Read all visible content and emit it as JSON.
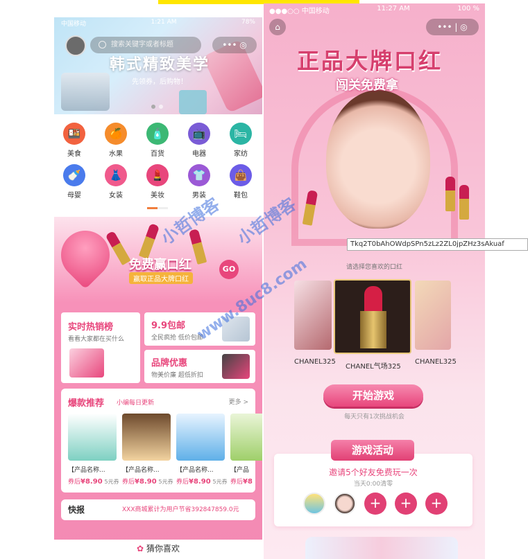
{
  "left": {
    "status": {
      "carrier": "中国移动",
      "time": "1:21 AM",
      "battery": "78%"
    },
    "search_placeholder": "搜索关键字或者标题",
    "capsule": "••• ◎",
    "banner": {
      "title": "韩式精致美学",
      "subtitle": "先领券，后购物！"
    },
    "categories": [
      {
        "label": "美食",
        "color": "#f2623f",
        "icon": "🍱"
      },
      {
        "label": "水果",
        "color": "#f58c2c",
        "icon": "🍊"
      },
      {
        "label": "百货",
        "color": "#3cb874",
        "icon": "🧴"
      },
      {
        "label": "电器",
        "color": "#7a5cd6",
        "icon": "📺"
      },
      {
        "label": "家纺",
        "color": "#2bb5a4",
        "icon": "🛏"
      },
      {
        "label": "母婴",
        "color": "#4a7bec",
        "icon": "🍼"
      },
      {
        "label": "女装",
        "color": "#f05a8c",
        "icon": "👗"
      },
      {
        "label": "美妆",
        "color": "#e8467c",
        "icon": "💄"
      },
      {
        "label": "男装",
        "color": "#9b59d6",
        "icon": "👕"
      },
      {
        "label": "鞋包",
        "color": "#6c5ce7",
        "icon": "👜"
      }
    ],
    "promo": {
      "title": "免费赢口红",
      "subtitle": "赢取正品大牌口红",
      "go": "GO"
    },
    "cards": [
      {
        "title": "实时热销榜",
        "sub": "看看大家都在买什么"
      },
      {
        "title": "9.9包邮",
        "sub": "全民疯抢 低价包邮"
      },
      {
        "title": "品牌优惠",
        "sub": "物美价廉 超低折扣"
      }
    ],
    "hot": {
      "title": "爆款推荐",
      "subtitle": "小编每日更新",
      "more": "更多 >",
      "products": [
        {
          "name": "【产品名称...",
          "prefix": "券后",
          "price": "¥8.90",
          "coupon": "5元券"
        },
        {
          "name": "【产品名称...",
          "prefix": "券后",
          "price": "¥8.90",
          "coupon": "5元券"
        },
        {
          "name": "【产品名称...",
          "prefix": "券后",
          "price": "¥8.90",
          "coupon": "5元券"
        },
        {
          "name": "【产品",
          "prefix": "券后",
          "price": "¥8",
          "coupon": ""
        }
      ]
    },
    "news": {
      "label": "快报",
      "text": "XXX商城累计为用户节省392847859.0元"
    },
    "guess": "猜你喜欢"
  },
  "right": {
    "status": {
      "carrier": "●●●○○ 中国移动",
      "time": "11:27 AM",
      "battery": "100 %"
    },
    "title": "正品大牌口红",
    "subtitle": "闯关免费拿",
    "tooltip": "Tkq2T0bAhOWdpSPn5zLz2ZL0jpZHz3sAkuaf",
    "choose": "请选择您喜欢的口红",
    "lipsticks": [
      {
        "name": "CHANEL325"
      },
      {
        "name": "CHANEL气场325"
      },
      {
        "name": "CHANEL325"
      }
    ],
    "start": "开始游戏",
    "once": "每天只有1次挑战机会",
    "activity": {
      "tab": "游戏活动",
      "invite": "邀请5个好友免费玩一次",
      "reset": "当天0:00清零"
    }
  },
  "watermarks": [
    "小哲博客",
    "小哲博客",
    "www.8uc8.com"
  ]
}
